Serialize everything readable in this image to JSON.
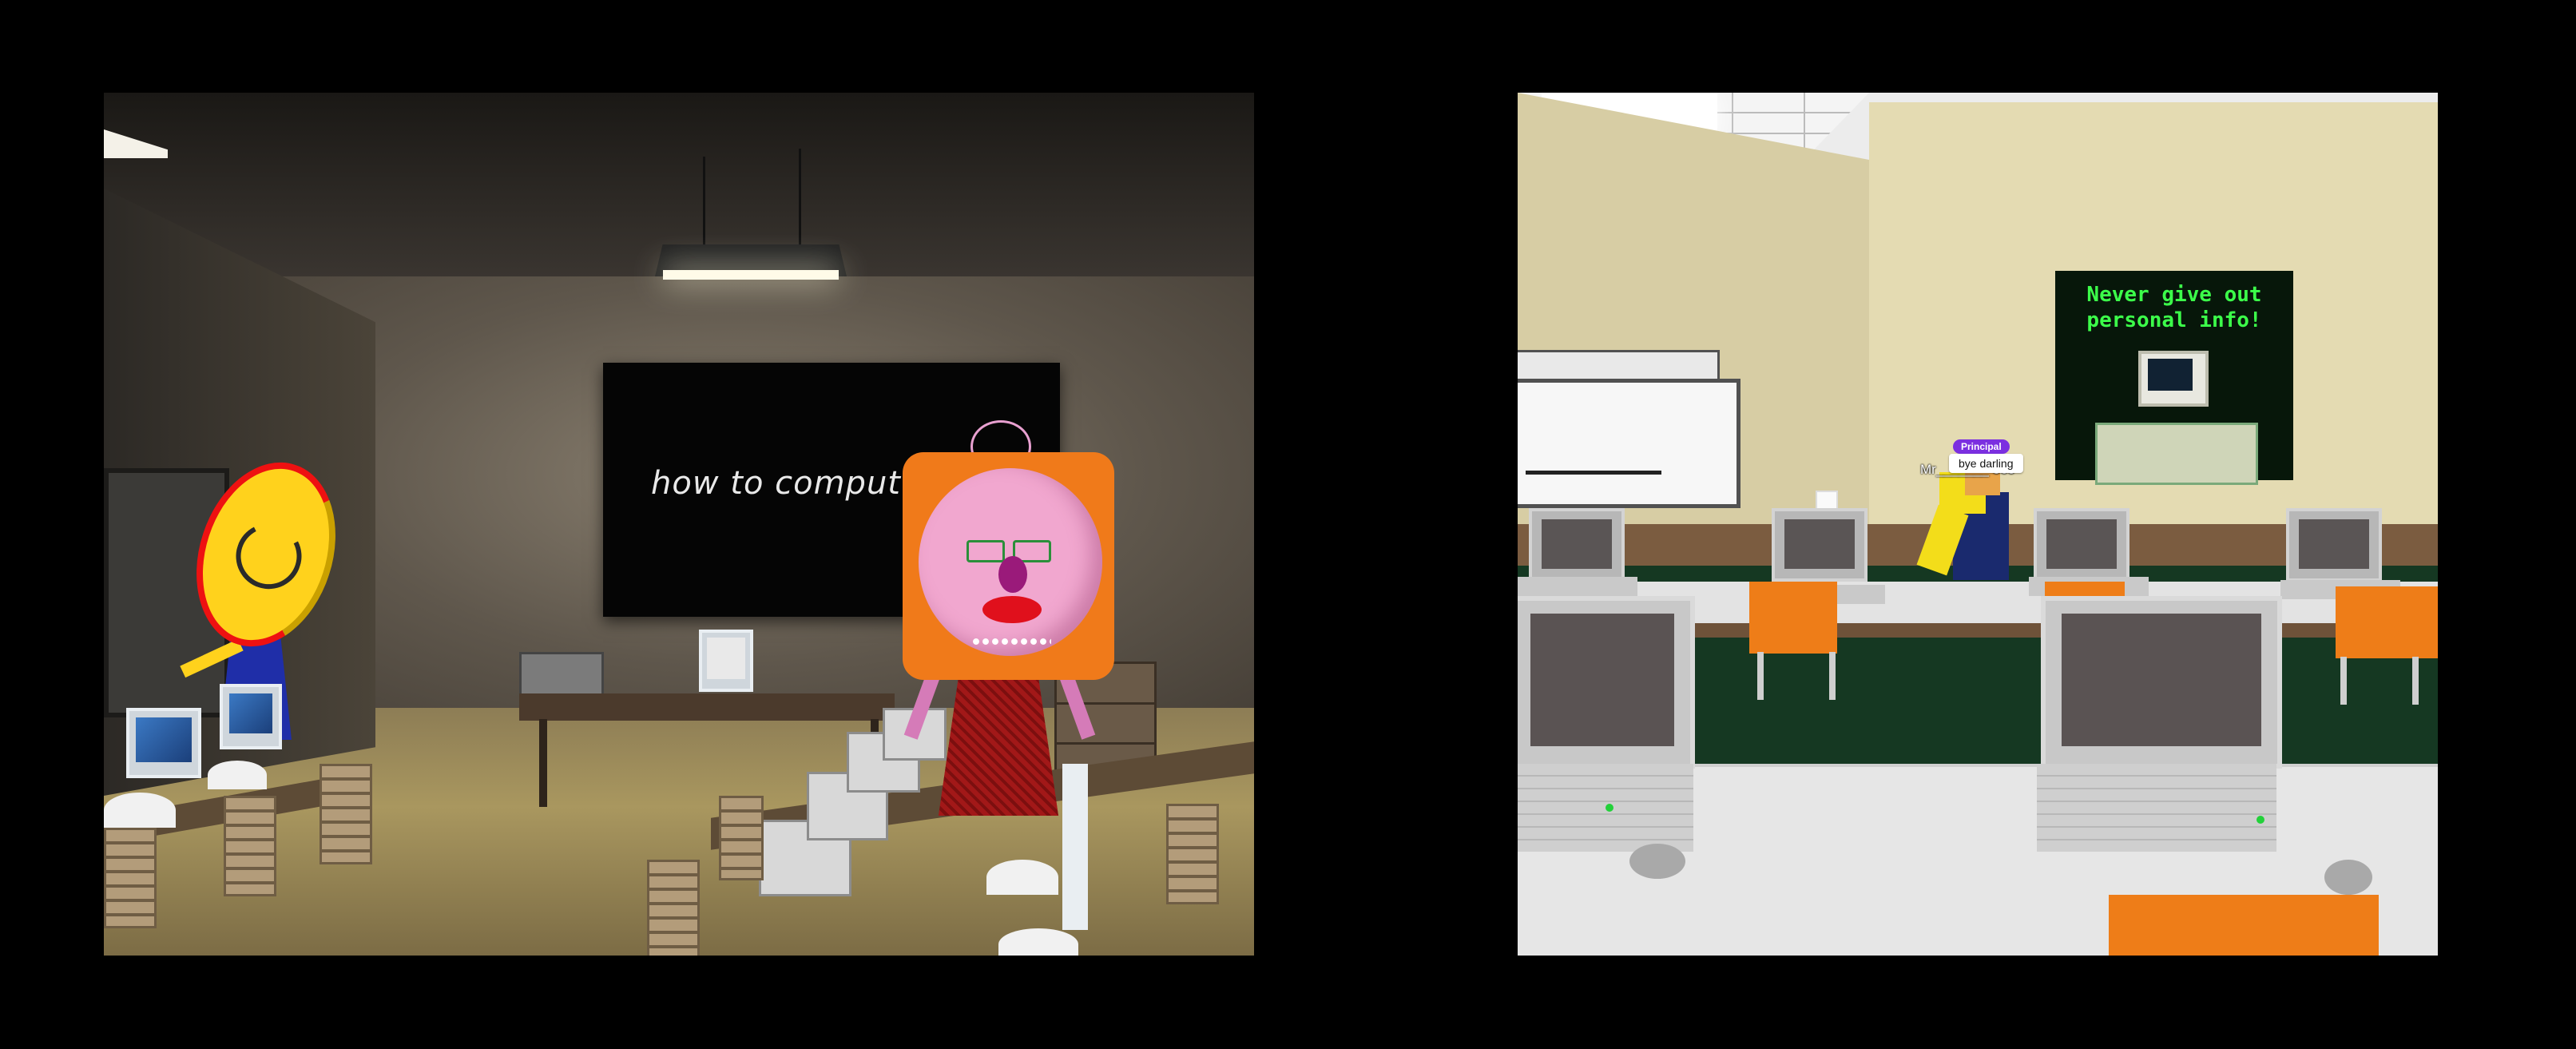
{
  "left_scene": {
    "blackboard_text": "how to comput"
  },
  "right_scene": {
    "poster_text_line1": "Never give out",
    "poster_text_line2": "personal info!",
    "npc": {
      "role_badge": "Principal",
      "name_tag": "Mr_______ 569",
      "chat_bubble": "bye darling"
    }
  },
  "colors": {
    "background": "#000000",
    "poster_text": "#3cff4a",
    "role_badge": "#7b2fe0",
    "chair_orange": "#ee7d18",
    "doll_hair": "#f07a1a",
    "doll_face": "#f1a7cf"
  }
}
